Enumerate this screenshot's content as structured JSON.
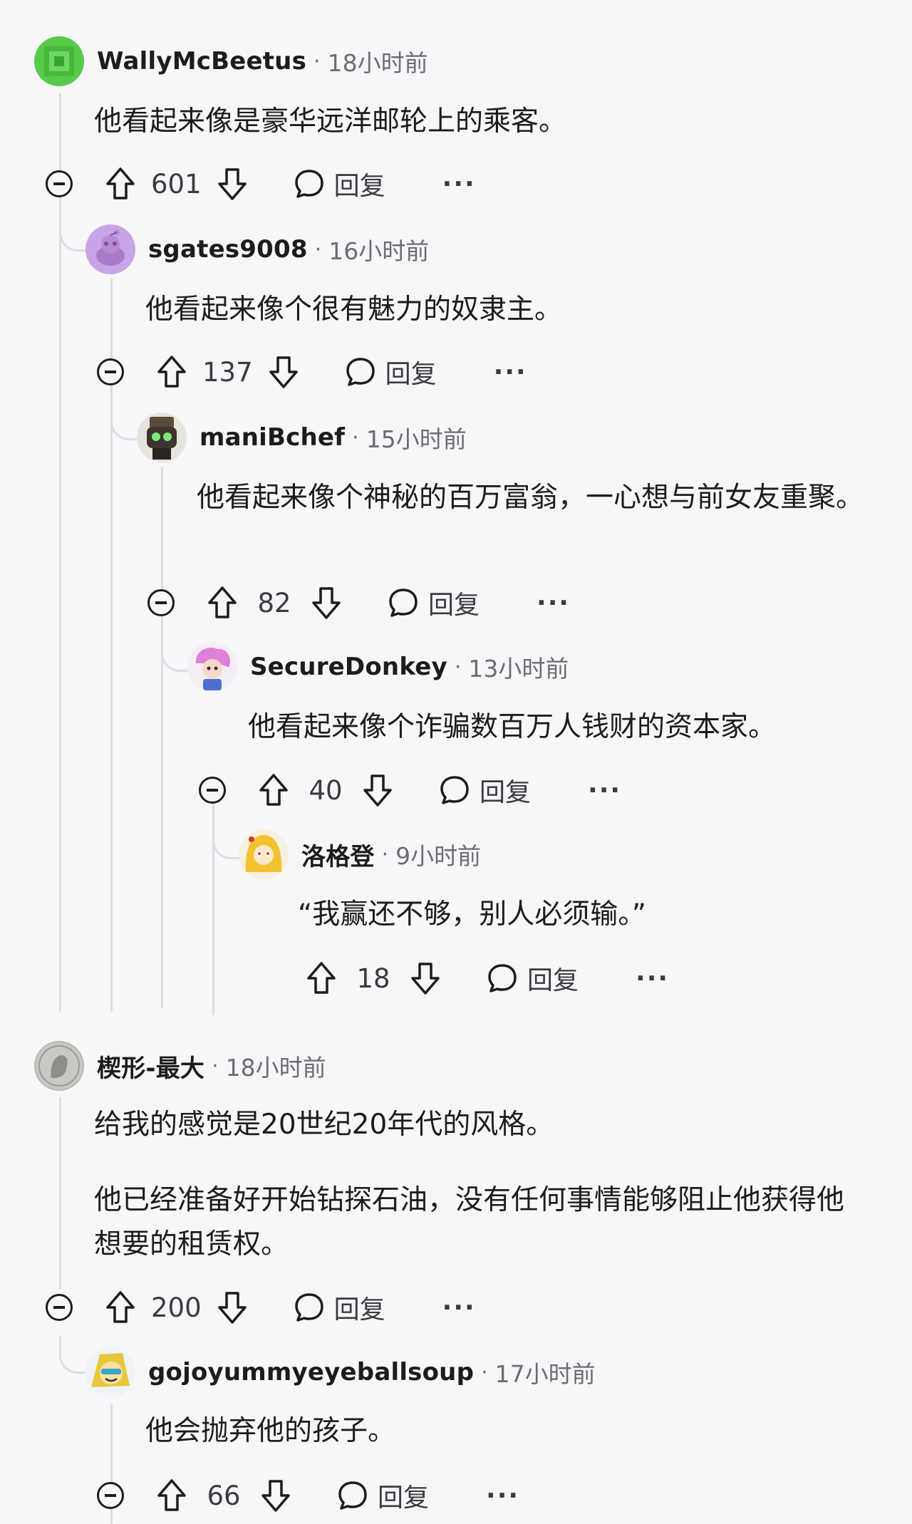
{
  "comments": [
    {
      "username": "WallyMcBeetus",
      "time": "18小时前",
      "text": [
        "他看起来像是豪华远洋邮轮上的乘客。"
      ],
      "score": "601",
      "reply_label": "回复",
      "avatar_icon": "pixel-green-avatar",
      "avatar_color": "#58c94a"
    },
    {
      "username": "sgates9008",
      "time": "16小时前",
      "text": [
        "他看起来像个很有魅力的奴隶主。"
      ],
      "score": "137",
      "reply_label": "回复",
      "avatar_icon": "snoo-default-avatar",
      "avatar_color": "#c9a4e8"
    },
    {
      "username": "maniBchef",
      "time": "15小时前",
      "text": [
        "他看起来像个神秘的百万富翁，一心想与前女友重聚。"
      ],
      "score": "82",
      "reply_label": "回复",
      "avatar_icon": "robot-chef-avatar",
      "avatar_color": "#5a4a3a"
    },
    {
      "username": "SecureDonkey",
      "time": "13小时前",
      "text": [
        "他看起来像个诈骗数百万人钱财的资本家。"
      ],
      "score": "40",
      "reply_label": "回复",
      "avatar_icon": "pink-hair-avatar",
      "avatar_color": "#e7a6e0"
    },
    {
      "username": "洛格登",
      "time": "9小时前",
      "text": [
        "“我赢还不够，别人必须输。”"
      ],
      "score": "18",
      "reply_label": "回复",
      "avatar_icon": "yellow-hood-avatar",
      "avatar_color": "#f2c230"
    },
    {
      "username": "楔形-最大",
      "time": "18小时前",
      "text": [
        "给我的感觉是20世纪20年代的风格。",
        "他已经准备好开始钻探石油，没有任何事情能够阻止他获得他想要的租赁权。"
      ],
      "score": "200",
      "reply_label": "回复",
      "avatar_icon": "coin-portrait-avatar",
      "avatar_color": "#b8b8b4"
    },
    {
      "username": "gojoyummyeyeballsoup",
      "time": "17小时前",
      "text": [
        "他会抛弃他的孩子。"
      ],
      "score": "66",
      "reply_label": "回复",
      "avatar_icon": "gojo-avatar",
      "avatar_color": "#e8c63c"
    }
  ],
  "separator": "·",
  "more_label": "···"
}
